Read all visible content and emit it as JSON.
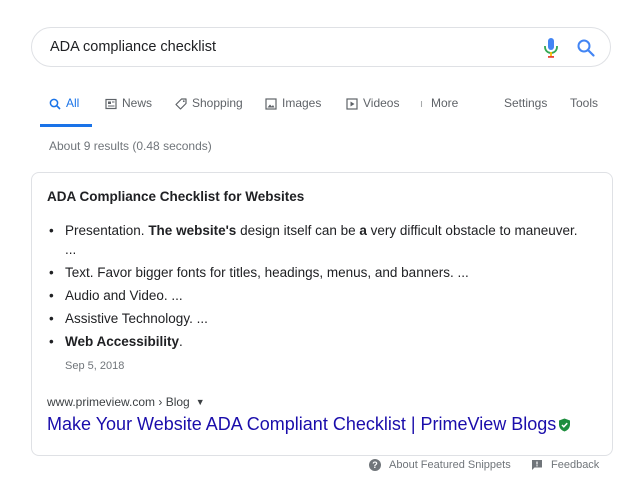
{
  "search": {
    "query": "ADA compliance checklist"
  },
  "tabs": [
    {
      "label": "All",
      "icon": "search-icon",
      "active": true
    },
    {
      "label": "News",
      "icon": "news-icon"
    },
    {
      "label": "Shopping",
      "icon": "tag-icon"
    },
    {
      "label": "Images",
      "icon": "image-icon"
    },
    {
      "label": "Videos",
      "icon": "play-icon"
    },
    {
      "label": "More",
      "icon": "more-vertical-icon"
    }
  ],
  "tools": {
    "settings_label": "Settings",
    "tools_label": "Tools"
  },
  "results_stats": "About 9 results (0.48 seconds)",
  "snippet": {
    "title": "ADA Compliance Checklist for Websites",
    "items": [
      {
        "prefix": "Presentation. ",
        "bold1": "The website's",
        "middle": " design itself can be ",
        "bold2": "a",
        "suffix": " very difficult obstacle to maneuver. ..."
      },
      {
        "text": "Text. Favor bigger fonts for titles, headings, menus, and banners. ..."
      },
      {
        "text": "Audio and Video. ..."
      },
      {
        "text": "Assistive Technology. ..."
      },
      {
        "bold": "Web Accessibility",
        "suffix": "."
      }
    ],
    "date": "Sep 5, 2018",
    "cite": "www.primeview.com › Blog",
    "link_title": "Make Your Website ADA Compliant Checklist | PrimeView Blogs"
  },
  "footer": {
    "about_label": "About Featured Snippets",
    "feedback_label": "Feedback"
  },
  "colors": {
    "accent": "#1a73e8",
    "link": "#1a0dab",
    "muted": "#70757a",
    "verified": "#1e8e3e"
  }
}
